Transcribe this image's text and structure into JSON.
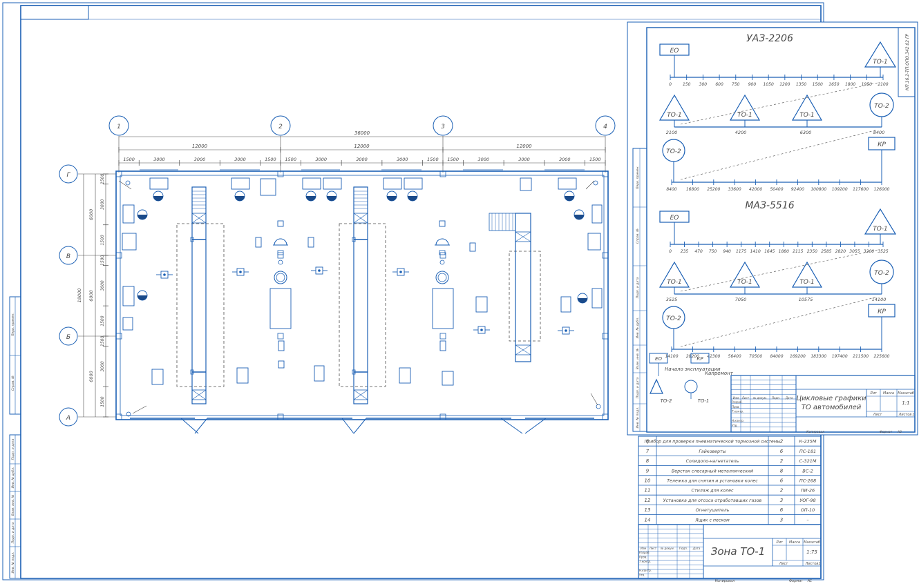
{
  "plan": {
    "axis_circles": [
      "1",
      "2",
      "3",
      "4"
    ],
    "row_circles": [
      "Г",
      "В",
      "Б",
      "А"
    ],
    "total_width": "36000",
    "span_widths": [
      "12000",
      "12000",
      "12000"
    ],
    "sub_dims": [
      [
        "1500",
        "3000",
        "3000",
        "3000",
        "1500"
      ],
      [
        "1500",
        "3000",
        "3000",
        "3000",
        "1500"
      ],
      [
        "1500",
        "3000",
        "3000",
        "3000",
        "1500"
      ]
    ],
    "side_total": "18000",
    "side_rows": [
      "6000",
      "6000",
      "6000"
    ],
    "side_sub": [
      "1500",
      "3000",
      "1500",
      "1500",
      "3000",
      "1500",
      "1500",
      "3000",
      "1500"
    ]
  },
  "sheet_title": {
    "title": "Зона ТО-1",
    "mass_label": "Масса",
    "scale_label": "Масштаб",
    "lit_label": "Лит",
    "scale_value": "1:75",
    "sheet_label": "Лист",
    "sheets_label": "Листов",
    "sheets_value": "1",
    "copied_label": "Копировал",
    "format_label": "Формат",
    "format_value": "А1",
    "rows": [
      "Изм",
      "Лист",
      "№ докум.",
      "Подп.",
      "Дата"
    ],
    "roles": [
      "Разраб.",
      "Пров.",
      "Т.контр.",
      "Н.контр.",
      "Утв."
    ]
  },
  "equipment_table": [
    {
      "n": "6",
      "name": "Прибор для проверки пневматической тормозной системы",
      "qty": "2",
      "model": "К-235М"
    },
    {
      "n": "7",
      "name": "Гайковерты",
      "qty": "6",
      "model": "ПС-181"
    },
    {
      "n": "8",
      "name": "Солидоло-нагнетатель",
      "qty": "2",
      "model": "С-321М"
    },
    {
      "n": "9",
      "name": "Верстак слесарный металлический",
      "qty": "8",
      "model": "ВС-2"
    },
    {
      "n": "10",
      "name": "Тележка для снятия и установки колес",
      "qty": "6",
      "model": "ПС-268"
    },
    {
      "n": "11",
      "name": "Стилаж для колес",
      "qty": "2",
      "model": "ПИ-26"
    },
    {
      "n": "12",
      "name": "Установка для отсоса отработавших газов",
      "qty": "3",
      "model": "УОГ-98"
    },
    {
      "n": "13",
      "name": "Огнетушитель",
      "qty": "6",
      "model": "ОП-10"
    },
    {
      "n": "14",
      "name": "Ящик с песком",
      "qty": "3",
      "model": "–"
    }
  ],
  "cycle_sheet": {
    "stamp_code": "КП.16.2-ТП.ОПО.342.02 ГР",
    "uaz": {
      "title": "УАЗ-2206",
      "eo": "ЕО",
      "to1": "ТО-1",
      "to2": "ТО-2",
      "kr": "КР",
      "scale1": [
        "0",
        "150",
        "300",
        "600",
        "750",
        "900",
        "1050",
        "1200",
        "1350",
        "1500",
        "1650",
        "1800",
        "1950",
        "2100"
      ],
      "scale2": [
        "2100",
        "4200",
        "6300",
        "8400"
      ],
      "scale3": [
        "8400",
        "16800",
        "25200",
        "33600",
        "42000",
        "50400",
        "92400",
        "100800",
        "109200",
        "117600",
        "126000"
      ]
    },
    "maz": {
      "title": "МАЗ-5516",
      "eo": "ЕО",
      "to1": "ТО-1",
      "to2": "ТО-2",
      "kr": "КР",
      "scale1": [
        "0",
        "235",
        "470",
        "750",
        "940",
        "1175",
        "1410",
        "1645",
        "1880",
        "2115",
        "2350",
        "2585",
        "2820",
        "3055",
        "3200",
        "3525"
      ],
      "scale2": [
        "3525",
        "7050",
        "10575",
        "14100"
      ],
      "scale3": [
        "14100",
        "28200",
        "42300",
        "56400",
        "70500",
        "84000",
        "169200",
        "183300",
        "197400",
        "211500",
        "225600"
      ]
    },
    "legend": {
      "eo": "ЕО",
      "eo_text": "Начало эксплуатации",
      "kr": "КР",
      "kr_text": "Капремонт",
      "to2": "ТО-2",
      "to1": "ТО-1"
    },
    "title": "Цикловые графики ТО автомобилей",
    "lit_label": "Лит",
    "mass_label": "Масса",
    "scale_label": "Масштаб",
    "scale_value": "1:1",
    "sheet_label": "Лист",
    "sheets_label": "Листов",
    "sheets_value": "1",
    "copied_label": "Копировал",
    "format_label": "Формат",
    "format_value": "А3",
    "rows": [
      "Изм",
      "Лист",
      "№ докум.",
      "Подп.",
      "Дата"
    ],
    "roles": [
      "Разраб.",
      "Пров.",
      "Т.контр.",
      "Н.контр.",
      "Утв."
    ]
  },
  "side_stamps": [
    "Перв. примен.",
    "Справ. №",
    "Подп. и дата",
    "Инв. № дубл.",
    "Взам. инв. №",
    "Подп. и дата",
    "Инв. № подл."
  ],
  "colors": {
    "line": "#1a5fb4",
    "dim": "#4a4a4a",
    "fill": "#1a4a8a"
  }
}
